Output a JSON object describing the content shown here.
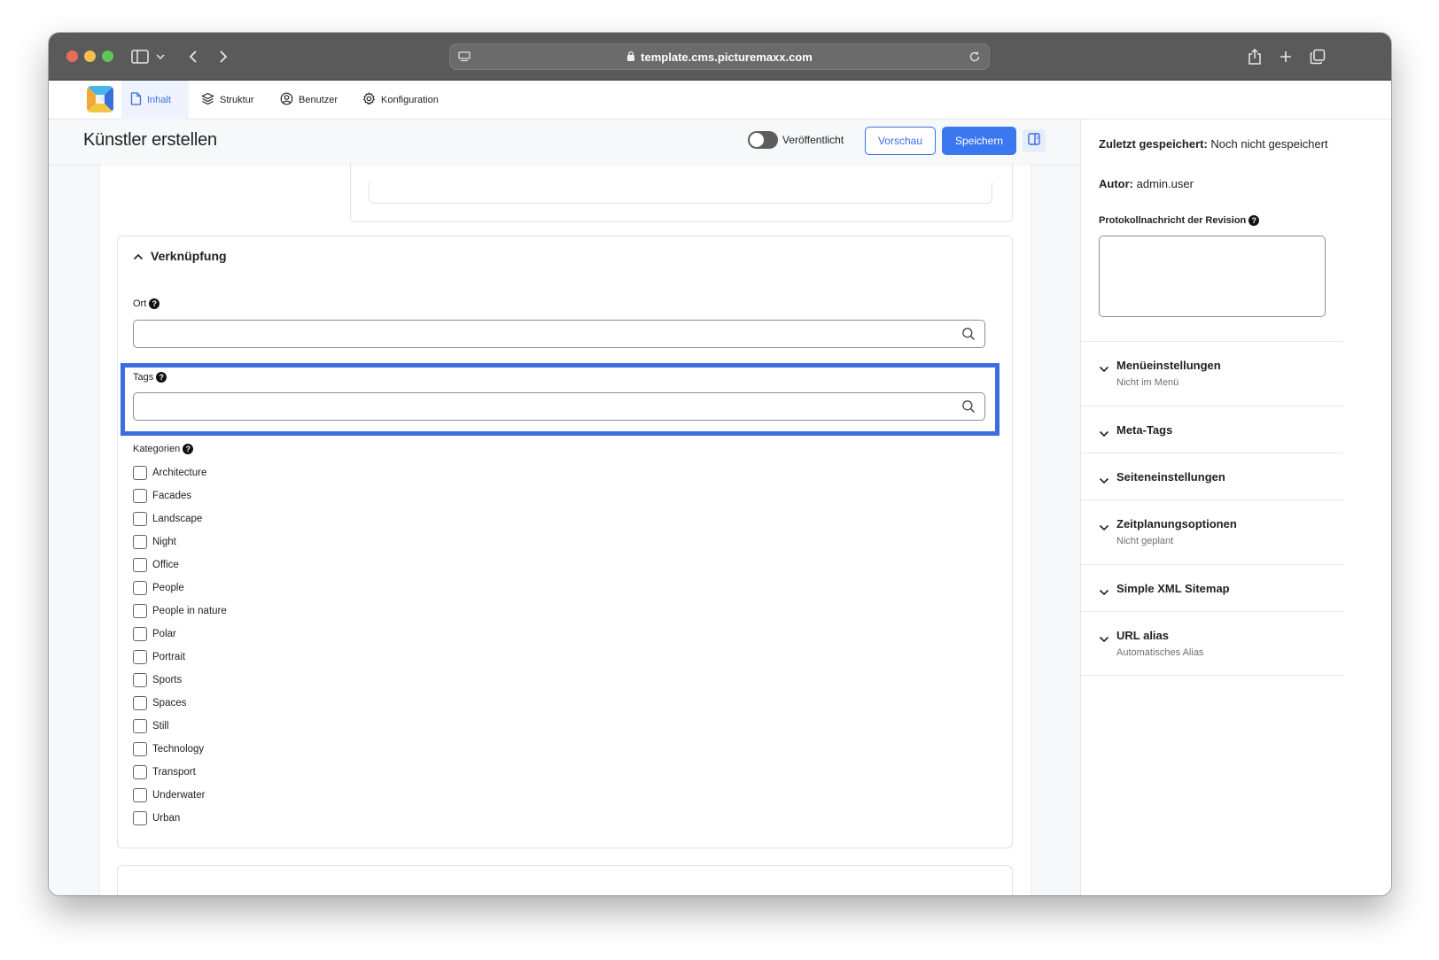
{
  "browser": {
    "url": "template.cms.picturemaxx.com"
  },
  "nav": {
    "items": [
      {
        "label": "Inhalt",
        "icon": "document-icon",
        "active": true
      },
      {
        "label": "Struktur",
        "icon": "layers-icon"
      },
      {
        "label": "Benutzer",
        "icon": "user-circle-icon"
      },
      {
        "label": "Konfiguration",
        "icon": "gear-icon"
      }
    ]
  },
  "header": {
    "title": "Künstler erstellen",
    "published_label": "Veröffentlicht",
    "preview_label": "Vorschau",
    "save_label": "Speichern"
  },
  "form": {
    "section_title": "Verknüpfung",
    "ort_label": "Ort",
    "tags_label": "Tags",
    "kategorien_label": "Kategorien",
    "categories": [
      "Architecture",
      "Facades",
      "Landscape",
      "Night",
      "Office",
      "People",
      "People in nature",
      "Polar",
      "Portrait",
      "Sports",
      "Spaces",
      "Still",
      "Technology",
      "Transport",
      "Underwater",
      "Urban"
    ]
  },
  "sidebar": {
    "last_saved_label": "Zuletzt gespeichert:",
    "last_saved_value": "Noch nicht gespeichert",
    "author_label": "Autor:",
    "author_value": "admin.user",
    "revision_label": "Protokollnachricht der Revision",
    "sections": [
      {
        "title": "Menüeinstellungen",
        "subtitle": "Nicht im Menü"
      },
      {
        "title": "Meta-Tags",
        "subtitle": ""
      },
      {
        "title": "Seiteneinstellungen",
        "subtitle": ""
      },
      {
        "title": "Zeitplanungsoptionen",
        "subtitle": "Nicht geplant"
      },
      {
        "title": "Simple XML Sitemap",
        "subtitle": ""
      },
      {
        "title": "URL alias",
        "subtitle": "Automatisches Alias"
      }
    ]
  },
  "colors": {
    "accent": "#3b78f0",
    "highlight": "#3b6fe0"
  }
}
